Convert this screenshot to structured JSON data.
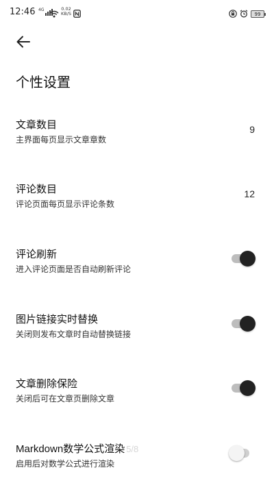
{
  "status_bar": {
    "time": "12:46",
    "signal_label": "4G",
    "net_speed_value": "0.02",
    "net_speed_unit": "KB/S",
    "battery": "99",
    "icons": [
      "signal-icon",
      "wifi-icon",
      "nfc-icon",
      "lock-icon",
      "alarm-icon",
      "battery-icon"
    ]
  },
  "toolbar": {
    "back_icon": "arrow-left-icon"
  },
  "page": {
    "title": "个性设置"
  },
  "settings": [
    {
      "title": "文章数目",
      "subtitle": "主界面每页显示文章章数",
      "value": "9"
    },
    {
      "title": "评论数目",
      "subtitle": "评论页面每页显示评论条数",
      "value": "12"
    },
    {
      "title": "评论刷新",
      "subtitle": "进入评论页面是否自动刷新评论",
      "toggle": true
    },
    {
      "title": "图片链接实时替换",
      "subtitle": "关闭则发布文章时自动替换链接",
      "toggle": true
    },
    {
      "title": "文章删除保险",
      "subtitle": "关闭后可在文章页删除文章",
      "toggle": true
    },
    {
      "title": "Markdown数学公式渲染",
      "overlay": "5/8",
      "subtitle": "启用后对数学公式进行渲染",
      "toggle": false
    }
  ],
  "colors": {
    "toggle_on_thumb": "#222222",
    "toggle_track": "#bdbdbd",
    "toggle_off_thumb": "#f4f4f4"
  }
}
